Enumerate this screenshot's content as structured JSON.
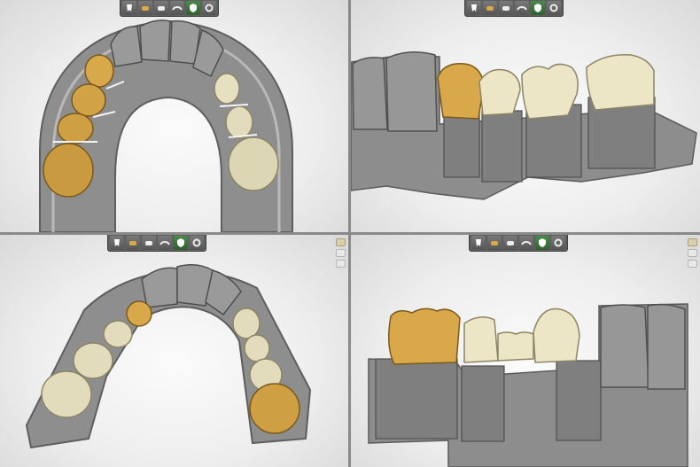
{
  "window": {
    "layout": "2x2 viewports"
  },
  "viewports": [
    {
      "id": "occlusal-view-1",
      "toolbar": [
        "model-tooth-icon",
        "gold-crown-icon",
        "white-crown-icon",
        "bridge-icon",
        "shield-icon",
        "gear-icon"
      ],
      "active_tool": 4
    },
    {
      "id": "side-view-1",
      "toolbar": [
        "model-tooth-icon",
        "gold-crown-icon",
        "white-crown-icon",
        "bridge-icon",
        "shield-icon",
        "gear-icon"
      ],
      "active_tool": 4
    },
    {
      "id": "occlusal-view-2",
      "toolbar": [
        "model-tooth-icon",
        "gold-crown-icon",
        "white-crown-icon",
        "bridge-icon",
        "shield-icon",
        "gear-icon"
      ],
      "active_tool": 4
    },
    {
      "id": "side-view-2",
      "toolbar": [
        "model-tooth-icon",
        "gold-crown-icon",
        "white-crown-icon",
        "bridge-icon",
        "shield-icon",
        "gear-icon"
      ],
      "active_tool": 4
    }
  ],
  "colors": {
    "gold": "#d8a84a",
    "ivory": "#ede6c6",
    "stone": "#8e8e8e",
    "bg": "#f3f3f3"
  }
}
